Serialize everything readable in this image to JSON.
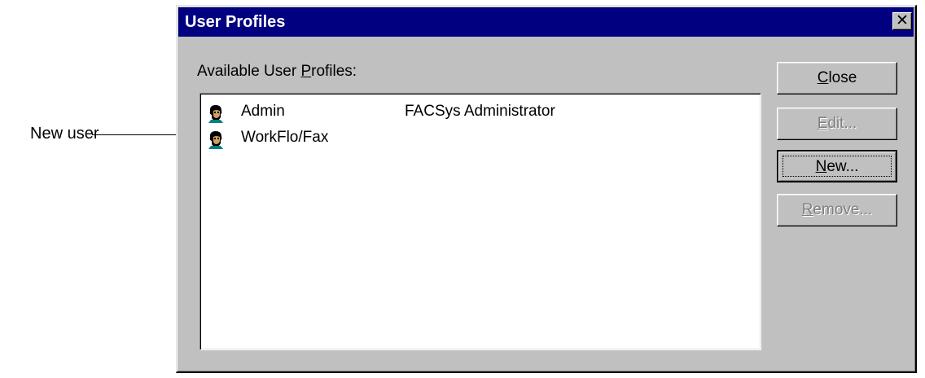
{
  "callout": {
    "label": "New user"
  },
  "dialog": {
    "title": "User Profiles",
    "close_glyph": "✕",
    "list_label_pre": "Available User ",
    "list_label_mn": "P",
    "list_label_post": "rofiles:",
    "profiles": [
      {
        "name": "Admin",
        "description": "FACSys Administrator",
        "icon": "user-head-icon"
      },
      {
        "name": "WorkFlo/Fax",
        "description": "",
        "icon": "user-head-icon"
      }
    ],
    "buttons": {
      "close": {
        "mn": "C",
        "rest": "lose",
        "enabled": true
      },
      "edit": {
        "mn": "E",
        "rest": "dit...",
        "enabled": false
      },
      "new": {
        "mn": "N",
        "rest": "ew...",
        "enabled": true,
        "default": true
      },
      "remove": {
        "mn": "R",
        "rest": "emove...",
        "enabled": false
      }
    }
  },
  "colors": {
    "titlebar": "#000080",
    "face": "#c0c0c0",
    "disabled_text": "#808080"
  }
}
